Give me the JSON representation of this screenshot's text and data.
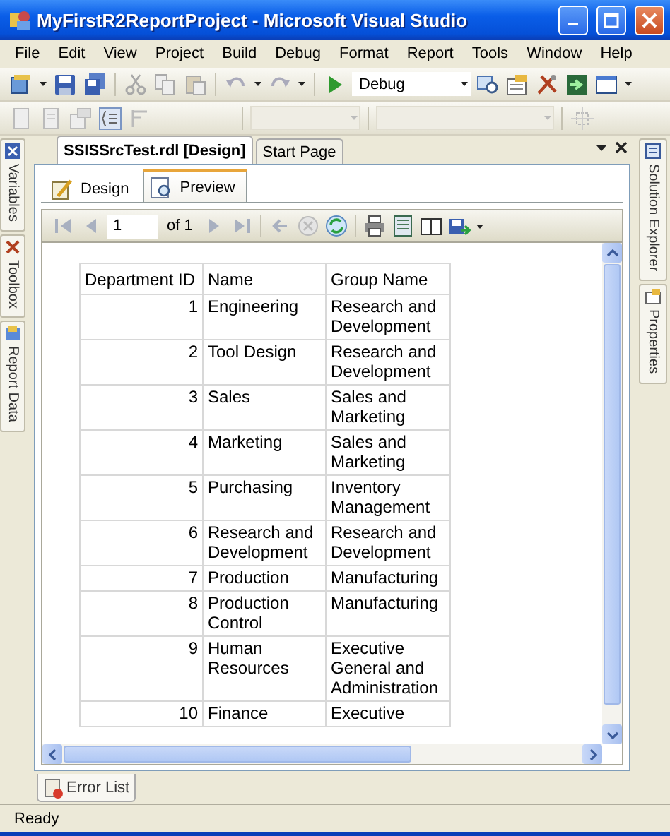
{
  "window": {
    "title": "MyFirstR2ReportProject - Microsoft Visual Studio"
  },
  "menu": [
    "File",
    "Edit",
    "View",
    "Project",
    "Build",
    "Debug",
    "Format",
    "Report",
    "Tools",
    "Window",
    "Help"
  ],
  "toolbar": {
    "configuration": "Debug"
  },
  "left_panels": [
    {
      "label": "Variables"
    },
    {
      "label": "Toolbox"
    },
    {
      "label": "Report Data"
    }
  ],
  "right_panels": [
    {
      "label": "Solution Explorer"
    },
    {
      "label": "Properties"
    }
  ],
  "document_tabs": [
    {
      "label": "SSISSrcTest.rdl [Design]",
      "selected": true
    },
    {
      "label": "Start Page",
      "selected": false
    }
  ],
  "view_tabs": [
    {
      "label": "Design",
      "selected": false
    },
    {
      "label": "Preview",
      "selected": true
    }
  ],
  "report_toolbar": {
    "page": "1",
    "page_count": "of 1"
  },
  "table": {
    "columns": [
      "Department ID",
      "Name",
      "Group Name"
    ],
    "rows": [
      [
        "1",
        "Engineering",
        "Research and Development"
      ],
      [
        "2",
        "Tool Design",
        "Research and Development"
      ],
      [
        "3",
        "Sales",
        "Sales and Marketing"
      ],
      [
        "4",
        "Marketing",
        "Sales and Marketing"
      ],
      [
        "5",
        "Purchasing",
        "Inventory Management"
      ],
      [
        "6",
        "Research and Development",
        "Research and Development"
      ],
      [
        "7",
        "Production",
        "Manufacturing"
      ],
      [
        "8",
        "Production Control",
        "Manufacturing"
      ],
      [
        "9",
        "Human Resources",
        "Executive General and Administration"
      ],
      [
        "10",
        "Finance",
        "Executive"
      ]
    ]
  },
  "bottom_tabs": [
    {
      "label": "Error List"
    }
  ],
  "status_bar": "Ready"
}
